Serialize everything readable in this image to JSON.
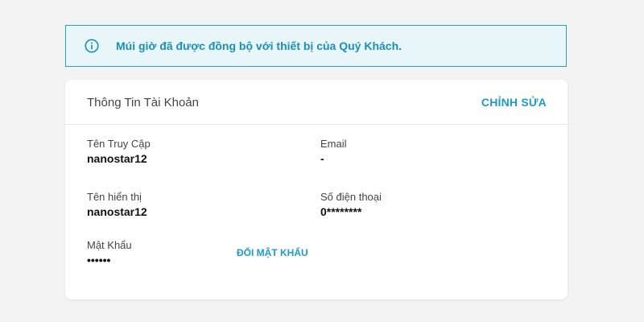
{
  "alert": {
    "icon": "info-icon",
    "message": "Múi giờ đã được đồng bộ với thiết bị của Quý Khách.",
    "colors": {
      "border": "#21a2c6",
      "background": "#e8f6fa",
      "text": "#1a8fb8"
    }
  },
  "account": {
    "title": "Thông Tin Tài Khoản",
    "edit_label": "CHỈNH SỬA",
    "username": {
      "label": "Tên Truy Cập",
      "value": "nanostar12"
    },
    "email": {
      "label": "Email",
      "value": "-"
    },
    "display_name": {
      "label": "Tên hiển thị",
      "value": "nanostar12"
    },
    "phone": {
      "label": "Số điện thoại",
      "value": "0********"
    },
    "password": {
      "label": "Mật Khẩu",
      "value": "••••••"
    },
    "change_password_label": "ĐỔI MẬT KHẨU"
  },
  "colors": {
    "accent": "#1c9bc6"
  }
}
